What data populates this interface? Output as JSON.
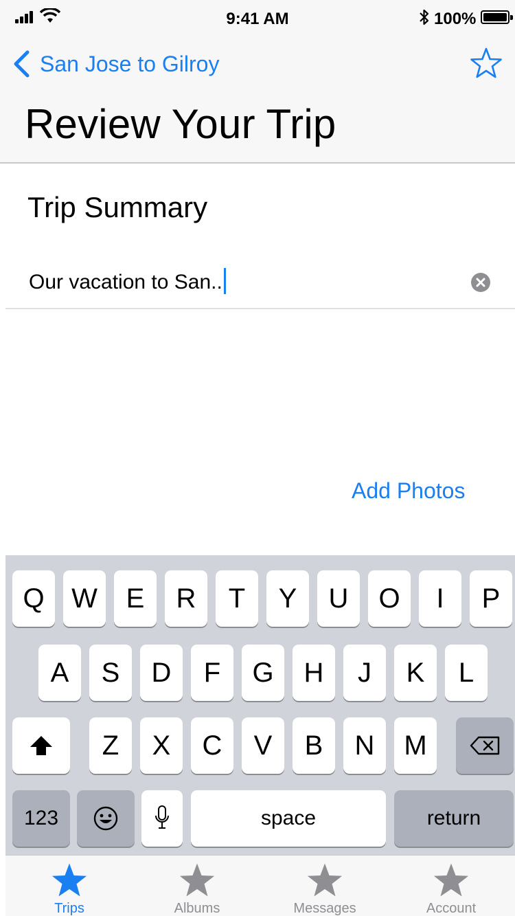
{
  "status_bar": {
    "time": "9:41 AM",
    "battery_percent": "100%",
    "battery_level": 1.0
  },
  "nav": {
    "back_label": "San Jose to Gilroy",
    "title": "Review Your Trip"
  },
  "content": {
    "section_heading": "Trip Summary",
    "summary_value": "Our vacation to San..",
    "add_photos_label": "Add Photos"
  },
  "keyboard": {
    "row1": [
      "Q",
      "W",
      "E",
      "R",
      "T",
      "Y",
      "U",
      "O",
      "I",
      "P"
    ],
    "row2": [
      "A",
      "S",
      "D",
      "F",
      "G",
      "H",
      "J",
      "K",
      "L"
    ],
    "row3": [
      "Z",
      "X",
      "C",
      "V",
      "B",
      "N",
      "M"
    ],
    "numbers_label": "123",
    "space_label": "space",
    "return_label": "return"
  },
  "tab_bar": {
    "tabs": [
      {
        "label": "Trips",
        "icon": "star-icon",
        "active": true
      },
      {
        "label": "Albums",
        "icon": "star-icon",
        "active": false
      },
      {
        "label": "Messages",
        "icon": "star-icon",
        "active": false
      },
      {
        "label": "Account",
        "icon": "star-icon",
        "active": false
      }
    ]
  },
  "colors": {
    "accent": "#1a7ff0",
    "inactive": "#8e8e93",
    "keyboard_bg": "#d0d3d9",
    "bar_bg": "#f7f7f7"
  }
}
